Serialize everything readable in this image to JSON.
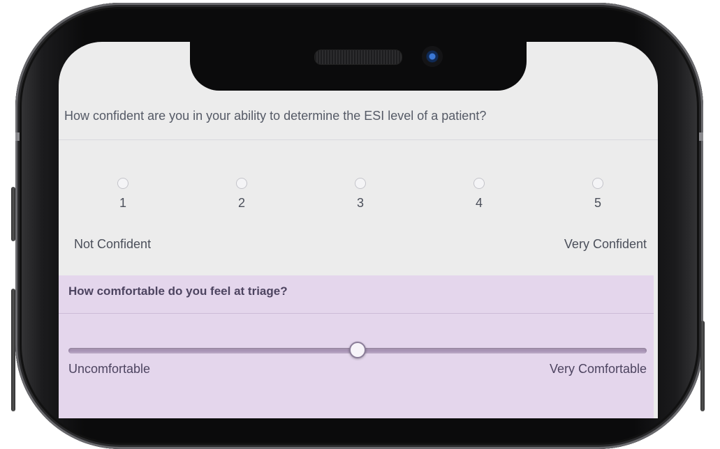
{
  "question1": {
    "text": "How confident are you in your ability to determine the ESI level of a patient?",
    "options": [
      "1",
      "2",
      "3",
      "4",
      "5"
    ],
    "min_label": "Not Confident",
    "max_label": "Very Confident",
    "selected": null
  },
  "question2": {
    "text": "How comfortable do you feel at triage?",
    "min_label": "Uncomfortable",
    "max_label": "Very Comfortable",
    "slider_value": 0.5
  },
  "colors": {
    "q2_background": "#e4d6ec",
    "q2_text": "#4d4460"
  }
}
